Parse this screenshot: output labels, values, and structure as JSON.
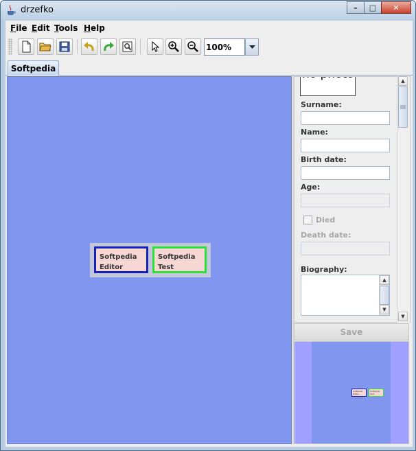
{
  "window": {
    "title": "drzefko",
    "minimize": "–",
    "maximize": "□",
    "close": "✕"
  },
  "menu": [
    {
      "label": "File"
    },
    {
      "label": "Edit"
    },
    {
      "label": "Tools"
    },
    {
      "label": "Help"
    }
  ],
  "toolbar": {
    "buttons": [
      "new-icon",
      "open-icon",
      "save-icon",
      "undo-icon",
      "redo-icon",
      "preview-icon",
      "pointer-icon",
      "zoom-in-icon",
      "zoom-out-icon"
    ],
    "zoom_value": "100%"
  },
  "tabs": [
    {
      "label": "Softpedia"
    }
  ],
  "tree": {
    "nodes": [
      {
        "line1": "Softpedia",
        "line2": "Editor",
        "border": "#1322b8"
      },
      {
        "line1": "Softpedia",
        "line2": "Test",
        "border": "#2fe03a"
      }
    ]
  },
  "properties": {
    "photo_text": "no photo",
    "surname_label": "Surname:",
    "name_label": "Name:",
    "birth_date_label": "Birth date:",
    "age_label": "Age:",
    "died_label": "Died",
    "death_date_label": "Death date:",
    "biography_label": "Biography:",
    "surname_value": "",
    "name_value": "",
    "birth_date_value": "",
    "age_value": "",
    "death_date_value": ""
  },
  "save_label": "Save",
  "colors": {
    "canvas": "#8196ef",
    "minimap": "#9fa0ff",
    "node_fill": "#f7d7d4"
  }
}
